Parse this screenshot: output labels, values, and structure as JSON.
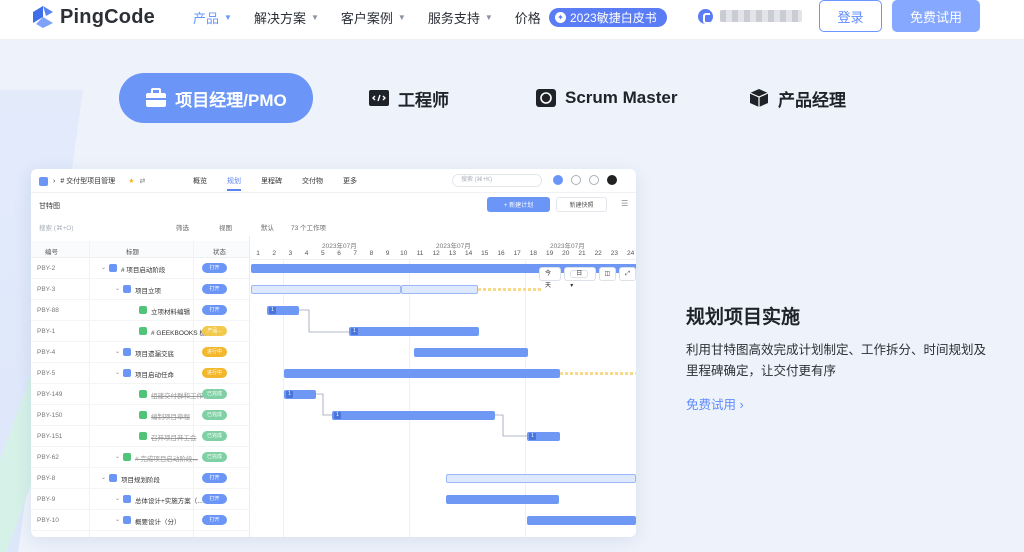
{
  "brand": {
    "name": "PingCode",
    "colors": {
      "accent": "#6b95f6",
      "link": "#5f8bff",
      "badge": "#5a7df5"
    }
  },
  "nav": {
    "menu": [
      {
        "label": "产品",
        "active": true
      },
      {
        "label": "解决方案"
      },
      {
        "label": "客户案例"
      },
      {
        "label": "服务支持"
      },
      {
        "label": "价格"
      }
    ],
    "whitepaper": "2023敏捷白皮书",
    "login": "登录",
    "trial": "免费试用"
  },
  "roles": [
    {
      "label": "项目经理/PMO",
      "icon": "briefcase-icon"
    },
    {
      "label": "工程师",
      "icon": "code-icon"
    },
    {
      "label": "Scrum Master",
      "icon": "scrum-icon"
    },
    {
      "label": "产品经理",
      "icon": "cube-icon"
    }
  ],
  "app": {
    "breadcrumb": "# 交付型项目管理",
    "tabs": [
      "概览",
      "规划",
      "里程碑",
      "交付物",
      "更多"
    ],
    "search_placeholder": "搜索 (⌘+K)",
    "subtitle": "甘特图",
    "new_plan": "+ 新建计划",
    "new_snapshot": "新建快照",
    "filter_search": "搜索 (⌘+O)",
    "filter": "筛选",
    "view": "视图",
    "default": "默认",
    "count": "73 个工作项",
    "columns": {
      "id": "编号",
      "title": "标题",
      "status": "状态"
    },
    "months": [
      "2023年07月",
      "2023年07月",
      "2023年07月"
    ],
    "days": [
      "1",
      "2",
      "3",
      "4",
      "5",
      "6",
      "7",
      "8",
      "9",
      "10",
      "11",
      "12",
      "13",
      "14",
      "15",
      "16",
      "17",
      "18",
      "19",
      "20",
      "21",
      "22",
      "23",
      "24"
    ],
    "controls": {
      "today": "今天",
      "unit": "日"
    },
    "rows": [
      {
        "id": "PBY-2",
        "title": "# 项目启动阶段",
        "status": "打开",
        "status_color": "#6b95f6",
        "level": 0,
        "type_color": "#6b95f6"
      },
      {
        "id": "PBY-3",
        "title": "项目立项",
        "status": "打开",
        "status_color": "#6b95f6",
        "level": 1,
        "type_color": "#6b95f6"
      },
      {
        "id": "PBY-88",
        "title": "立项材料编辑",
        "status": "打开",
        "status_color": "#6b95f6",
        "level": 2,
        "type_color": "#52c47a"
      },
      {
        "id": "PBY-1",
        "title": "# GEEKBOOKS 极...",
        "status": "产品...",
        "status_color": "#f2c94c",
        "level": 2,
        "type_color": "#52c47a"
      },
      {
        "id": "PBY-4",
        "title": "项目遗漏交底",
        "status": "进行中",
        "status_color": "#f2b72c",
        "level": 1,
        "type_color": "#6b95f6"
      },
      {
        "id": "PBY-5",
        "title": "项目启动任命",
        "status": "进行中",
        "status_color": "#f2b72c",
        "level": 1,
        "type_color": "#6b95f6"
      },
      {
        "id": "PBY-149",
        "title": "组建交付群和工作台",
        "status": "已完成",
        "status_color": "#7fd0a4",
        "level": 2,
        "type_color": "#52c47a",
        "done": true
      },
      {
        "id": "PBY-150",
        "title": "编制项目章程",
        "status": "已完成",
        "status_color": "#7fd0a4",
        "level": 2,
        "type_color": "#52c47a",
        "done": true
      },
      {
        "id": "PBY-151",
        "title": "召开项目开工会",
        "status": "已完成",
        "status_color": "#7fd0a4",
        "level": 2,
        "type_color": "#52c47a",
        "done": true
      },
      {
        "id": "PBY-62",
        "title": "# 完成项目启动阶段...",
        "status": "已完成",
        "status_color": "#7fd0a4",
        "level": 1,
        "type_color": "#52c47a",
        "done": true
      },
      {
        "id": "PBY-8",
        "title": "项目规划阶段",
        "status": "打开",
        "status_color": "#6b95f6",
        "level": 0,
        "type_color": "#6b95f6"
      },
      {
        "id": "PBY-9",
        "title": "总体设计+实施方案（...",
        "status": "打开",
        "status_color": "#6b95f6",
        "level": 1,
        "type_color": "#6b95f6"
      },
      {
        "id": "PBY-10",
        "title": "概要设计（分）",
        "status": "打开",
        "status_color": "#6b95f6",
        "level": 1,
        "type_color": "#6b95f6"
      }
    ]
  },
  "feature": {
    "title": "规划项目实施",
    "desc": "利用甘特图高效完成计划制定、工作拆分、时间规划及里程碑确定，让交付更有序",
    "link": "免费试用 ›"
  }
}
